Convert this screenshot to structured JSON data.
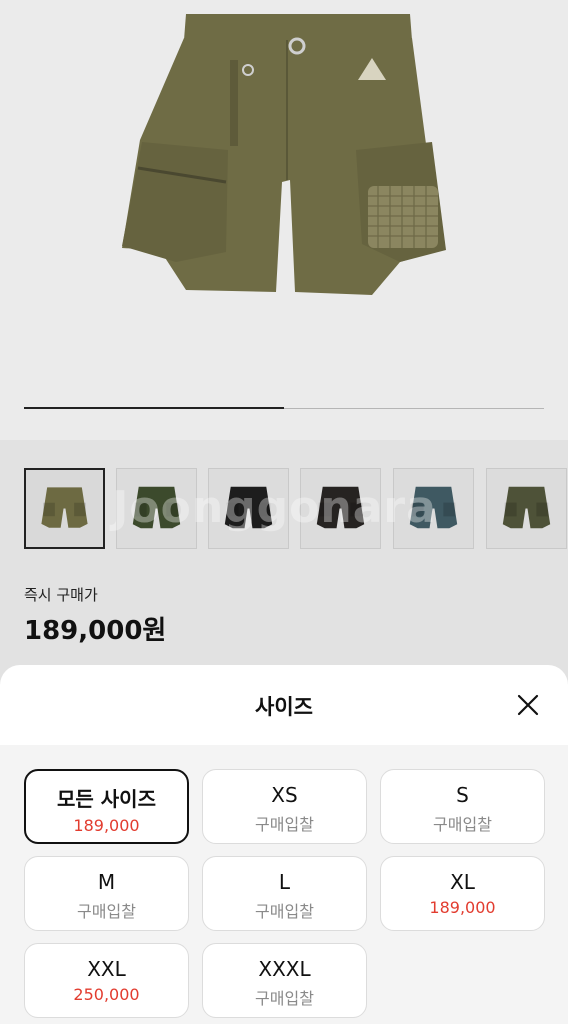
{
  "product": {
    "gallery_progress": 0.5,
    "watermark": "Joonggonara"
  },
  "thumbnails": [
    {
      "color": "#6d6a42",
      "bg": "#d9d9d9"
    },
    {
      "color": "#3c4a2c",
      "bg": "#dcdcdc"
    },
    {
      "color": "#1d1d1d",
      "bg": "#dcdcdc"
    },
    {
      "color": "#262321",
      "bg": "#dcdcdc"
    },
    {
      "color": "#3f5962",
      "bg": "#dcdcdc"
    },
    {
      "color": "#4e5238",
      "bg": "#dcdcdc"
    }
  ],
  "price": {
    "label": "즉시 구매가",
    "value": "189,000원"
  },
  "sheet": {
    "title": "사이즈",
    "close_icon": "close-icon"
  },
  "sizes": [
    {
      "name": "모든 사이즈",
      "sub": "189,000",
      "has_price": true,
      "selected": true
    },
    {
      "name": "XS",
      "sub": "구매입찰",
      "has_price": false
    },
    {
      "name": "S",
      "sub": "구매입찰",
      "has_price": false
    },
    {
      "name": "M",
      "sub": "구매입찰",
      "has_price": false
    },
    {
      "name": "L",
      "sub": "구매입찰",
      "has_price": false
    },
    {
      "name": "XL",
      "sub": "189,000",
      "has_price": true
    },
    {
      "name": "XXL",
      "sub": "250,000",
      "has_price": true
    },
    {
      "name": "XXXL",
      "sub": "구매입찰",
      "has_price": false
    }
  ],
  "colors": {
    "price_red": "#e23c2f",
    "shorts_olive": "#6f6c45"
  }
}
